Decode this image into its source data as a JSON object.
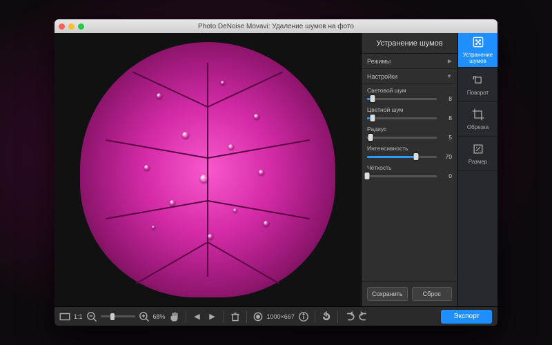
{
  "window": {
    "title": "Photo DeNoise Movavi: Удаление шумов на фото"
  },
  "panel": {
    "header": "Устранение шумов",
    "modes_label": "Режимы",
    "settings_label": "Настройки",
    "sliders": [
      {
        "label": "Световой шум",
        "value": 8,
        "max": 100
      },
      {
        "label": "Цветной шум",
        "value": 8,
        "max": 100
      },
      {
        "label": "Радиус",
        "value": 5,
        "max": 100
      },
      {
        "label": "Интенсивность",
        "value": 70,
        "max": 100
      },
      {
        "label": "Чёткость",
        "value": 0,
        "max": 100
      }
    ],
    "save_label": "Сохранить",
    "reset_label": "Сброс"
  },
  "tabs": [
    {
      "label": "Устранение шумов",
      "icon": "denoise-icon",
      "active": true
    },
    {
      "label": "Поворот",
      "icon": "rotate-icon",
      "active": false
    },
    {
      "label": "Обрезка",
      "icon": "crop-icon",
      "active": false
    },
    {
      "label": "Размер",
      "icon": "resize-icon",
      "active": false
    }
  ],
  "toolbar": {
    "zoom_percent": "68%",
    "fit_label": "1:1",
    "dimensions": "1000×667",
    "export_label": "Экспорт"
  }
}
